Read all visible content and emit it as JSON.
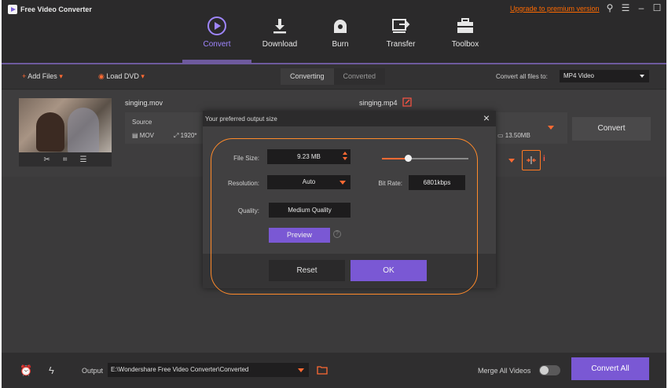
{
  "app": {
    "title": "Free Video Converter",
    "upgrade_link": "Upgrade to premium version"
  },
  "nav": {
    "tabs": [
      {
        "label": "Convert",
        "icon": "convert-icon",
        "active": true
      },
      {
        "label": "Download",
        "icon": "download-icon"
      },
      {
        "label": "Burn",
        "icon": "burn-icon"
      },
      {
        "label": "Transfer",
        "icon": "transfer-icon"
      },
      {
        "label": "Toolbox",
        "icon": "toolbox-icon"
      }
    ]
  },
  "toolbar": {
    "add_files": "Add Files",
    "load_dvd": "Load DVD",
    "segments": [
      "Converting",
      "Converted"
    ],
    "convert_all_label": "Convert all files to:",
    "convert_all_format": "MP4 Video"
  },
  "file": {
    "source_name": "singing.mov",
    "source_label": "Source",
    "source_format": "MOV",
    "source_resolution": "1920*",
    "output_name": "singing.mp4",
    "output_size": "13.50MB",
    "convert_button": "Convert"
  },
  "dialog": {
    "title": "Your preferred output size",
    "file_size_label": "File Size:",
    "file_size_value": "9.23  MB",
    "resolution_label": "Resolution:",
    "resolution_value": "Auto",
    "bit_rate_label": "Bit Rate:",
    "bit_rate_value": "6801kbps",
    "quality_label": "Quality:",
    "quality_value": "Medium Quality",
    "preview_button": "Preview",
    "reset_button": "Reset",
    "ok_button": "OK",
    "size_slider_fraction": 0.3
  },
  "bottom": {
    "output_label": "Output",
    "output_path": "E:\\Wondershare Free Video Converter\\Converted",
    "merge_label": "Merge All Videos",
    "convert_all_button": "Convert All"
  },
  "colors": {
    "accent": "#7a58d4",
    "highlight": "#ff6a33"
  }
}
